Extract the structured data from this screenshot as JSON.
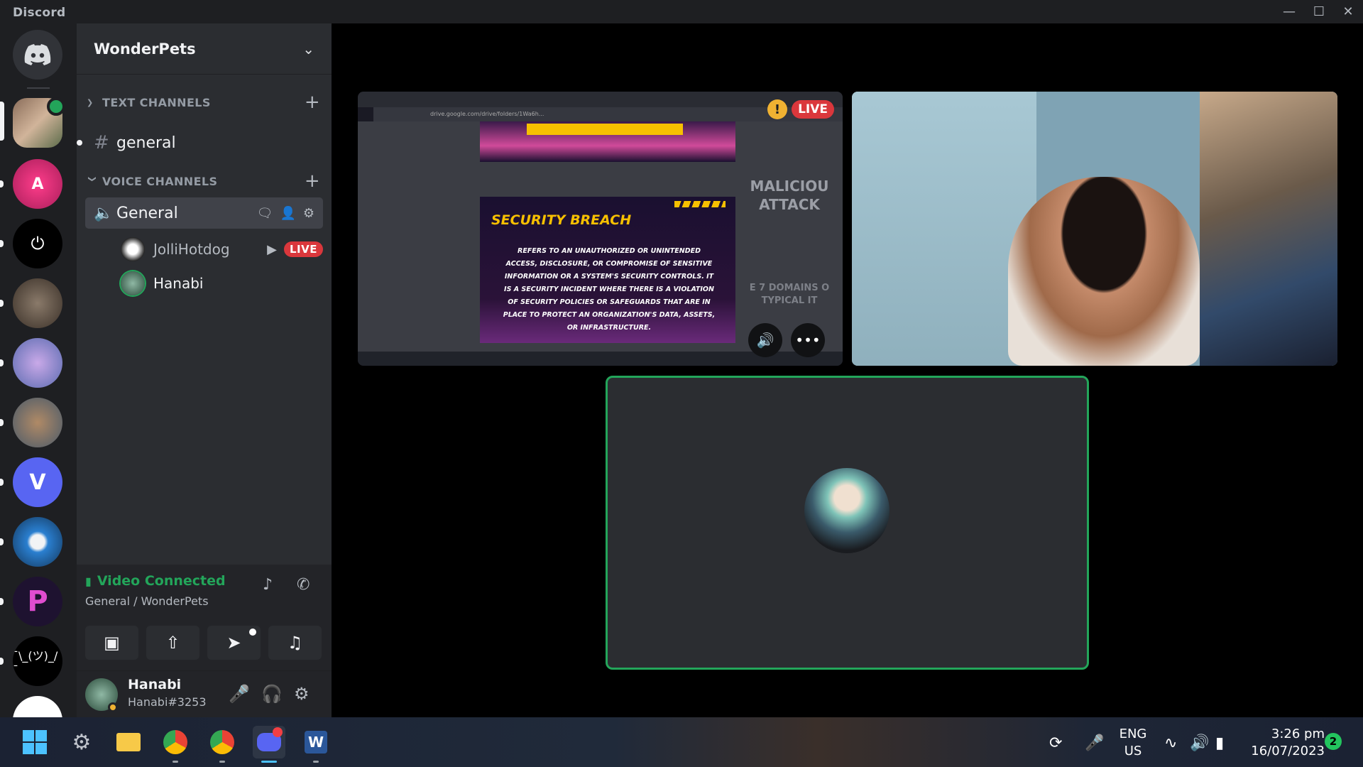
{
  "window": {
    "title": "Discord"
  },
  "guild": {
    "name": "WonderPets"
  },
  "categories": {
    "text": "TEXT CHANNELS",
    "voice": "VOICE CHANNELS"
  },
  "text_channel": {
    "name": "general"
  },
  "voice_channel": {
    "name": "General",
    "members": [
      {
        "name": "JolliHotdog",
        "badge": "LIVE"
      },
      {
        "name": "Hanabi"
      }
    ]
  },
  "voice_panel": {
    "status": "Video Connected",
    "location": "General / WonderPets"
  },
  "user": {
    "name": "Hanabi",
    "tag": "Hanabi#3253"
  },
  "stream": {
    "live_label": "LIVE",
    "warning": "!",
    "slide_title": "SECURITY BREACH",
    "slide_body": "REFERS TO AN UNAUTHORIZED OR UNINTENDED ACCESS, DISCLOSURE, OR COMPROMISE OF SENSITIVE INFORMATION OR A SYSTEM'S SECURITY CONTROLS. IT IS A SECURITY INCIDENT WHERE THERE IS A VIOLATION OF SECURITY POLICIES OR SAFEGUARDS THAT ARE IN PLACE TO PROTECT AN ORGANIZATION'S DATA, ASSETS, OR INFRASTRUCTURE.",
    "side_text_1": "MALICIOU ATTACK",
    "side_text_2": "E 7 DOMAINS O TYPICAL IT",
    "url": "drive.google.com/drive/folders/1Wa6h..."
  },
  "taskbar": {
    "lang_top": "ENG",
    "lang_bottom": "US",
    "time": "3:26 pm",
    "date": "16/07/2023",
    "notifications": "2"
  },
  "colors": {
    "accent_green": "#23a55a",
    "live_red": "#da373c",
    "sidebar": "#2b2d31",
    "rail": "#1e1f22"
  },
  "icons": [
    "discord-logo-icon",
    "hash-icon",
    "speaker-icon",
    "plus-icon",
    "chevron-down-icon",
    "camera-icon",
    "screen-share-icon",
    "rocket-icon",
    "soundboard-icon",
    "microphone-icon",
    "headphones-icon",
    "gear-icon",
    "signal-icon",
    "disconnect-icon",
    "volume-icon",
    "more-icon"
  ]
}
